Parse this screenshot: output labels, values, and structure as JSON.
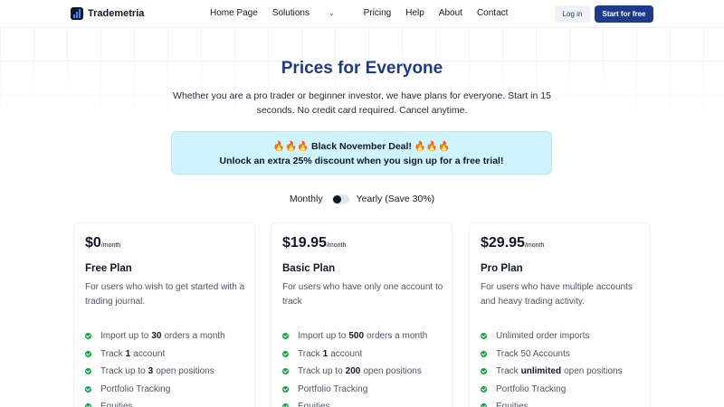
{
  "nav": {
    "brand": "Trademetria",
    "links": [
      "Home Page",
      "Solutions",
      "Pricing",
      "Help",
      "About",
      "Contact"
    ],
    "solutions_icon": "chevron-down-icon",
    "login": "Log in",
    "start": "Start for free"
  },
  "hero": {
    "title": "Prices for Everyone",
    "subtitle": "Whether you are a pro trader or beginner investor, we have plans for everyone. Start in 15 seconds. No credit card required. Cancel anytime."
  },
  "deal": {
    "fire": "🔥🔥🔥",
    "title": "Black November Deal!",
    "line2_bold": "Unlock",
    "line2_rest": "an extra 25% discount when you sign up for a free trial!"
  },
  "billing": {
    "monthly": "Monthly",
    "yearly": "Yearly (Save 30%)",
    "selected": "Monthly"
  },
  "plans": [
    {
      "price": "$0",
      "period": "/month",
      "name": "Free Plan",
      "desc": "For users who wish to get started with a trading journal.",
      "features": [
        {
          "pre": "Import up to",
          "bold": "30",
          "post": "orders a month"
        },
        {
          "pre": "Track",
          "bold": "1",
          "post": "account"
        },
        {
          "pre": "Track up to",
          "bold": "3",
          "post": "open positions"
        },
        {
          "pre": "Portfolio Tracking",
          "bold": "",
          "post": ""
        },
        {
          "pre": "Equities",
          "bold": "",
          "post": ""
        }
      ]
    },
    {
      "price": "$19.95",
      "period": "/month",
      "name": "Basic Plan",
      "desc": "For users who have only one account to track",
      "features": [
        {
          "pre": "Import up to",
          "bold": "500",
          "post": "orders a month"
        },
        {
          "pre": "Track",
          "bold": "1",
          "post": "account"
        },
        {
          "pre": "Track up to",
          "bold": "200",
          "post": "open positions"
        },
        {
          "pre": "Portfolio Tracking",
          "bold": "",
          "post": ""
        },
        {
          "pre": "Equities",
          "bold": "",
          "post": ""
        }
      ]
    },
    {
      "price": "$29.95",
      "period": "/month",
      "name": "Pro Plan",
      "desc": "For users who have multiple accounts and heavy trading activity.",
      "features": [
        {
          "pre": "Unlimited order imports",
          "bold": "",
          "post": ""
        },
        {
          "pre": "Track 50 Accounts",
          "bold": "",
          "post": ""
        },
        {
          "pre": "Track",
          "bold": "unlimited",
          "post": "open positions"
        },
        {
          "pre": "Portfolio Tracking",
          "bold": "",
          "post": ""
        },
        {
          "pre": "Equities",
          "bold": "",
          "post": ""
        }
      ]
    }
  ],
  "colors": {
    "brand": "#1e3a8a",
    "deal_bg": "#cff3fb",
    "check": "#16a34a"
  }
}
